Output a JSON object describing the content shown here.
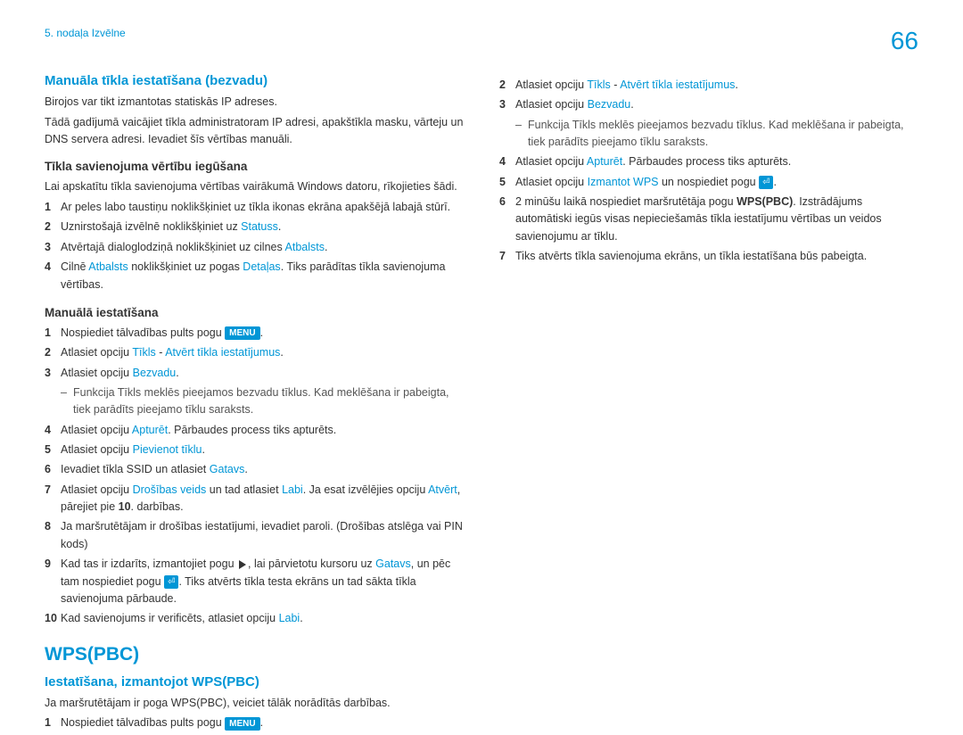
{
  "header": {
    "chapter": "5. nodaļa Izvēlne",
    "page": "66"
  },
  "left": {
    "h2a": "Manuāla tīkla iestatīšana (bezvadu)",
    "p1": "Birojos var tikt izmantotas statiskās IP adreses.",
    "p2": "Tādā gadījumā vaicājiet tīkla administratoram IP adresi, apakštīkla masku, vārteju un DNS servera adresi. Ievadiet šīs vērtības manuāli.",
    "h3a": "Tīkla savienojuma vērtību iegūšana",
    "p3": "Lai apskatītu tīkla savienojuma vērtības vairākumā Windows datoru, rīkojieties šādi.",
    "s1": {
      "1": "Ar peles labo taustiņu noklikšķiniet uz tīkla ikonas ekrāna apakšējā labajā stūrī.",
      "2a": "Uznirstošajā izvēlnē noklikšķiniet uz ",
      "2b": "Statuss",
      "2c": ".",
      "3a": "Atvērtajā dialoglodziņā noklikšķiniet uz cilnes ",
      "3b": "Atbalsts",
      "3c": ".",
      "4a": "Cilnē ",
      "4b": "Atbalsts",
      "4c": " noklikšķiniet uz pogas ",
      "4d": "Detaļas",
      "4e": ". Tiks parādītas tīkla savienojuma vērtības."
    },
    "h3b": "Manuālā iestatīšana",
    "s2": {
      "1a": "Nospiediet tālvadības pults pogu ",
      "1b": "MENU",
      "1c": ".",
      "2a": "Atlasiet opciju ",
      "2b": "Tīkls",
      "2c": " - ",
      "2d": "Atvērt tīkla iestatījumus",
      "2e": ".",
      "3a": "Atlasiet opciju ",
      "3b": "Bezvadu",
      "3c": ".",
      "sub1": "Funkcija Tīkls meklēs pieejamos bezvadu tīklus. Kad meklēšana ir pabeigta, tiek parādīts pieejamo tīklu saraksts.",
      "4a": "Atlasiet opciju ",
      "4b": "Apturēt",
      "4c": ". Pārbaudes process tiks apturēts.",
      "5a": "Atlasiet opciju ",
      "5b": "Pievienot tīklu",
      "5c": ".",
      "6a": "Ievadiet tīkla SSID un atlasiet ",
      "6b": "Gatavs",
      "6c": ".",
      "7a": "Atlasiet opciju ",
      "7b": "Drošības veids",
      "7c": " un tad atlasiet ",
      "7d": "Labi",
      "7e": ". Ja esat izvēlējies opciju ",
      "7f": "Atvērt",
      "7g": ", pārejiet pie ",
      "7h": "10",
      "7i": ". darbības.",
      "8": "Ja maršrutētājam ir drošības iestatījumi, ievadiet paroli. (Drošības atslēga vai PIN kods)",
      "9a": "Kad tas ir izdarīts, izmantojiet pogu ",
      "9b": ", lai pārvietotu kursoru uz ",
      "9c": "Gatavs",
      "9d": ", un pēc tam nospiediet pogu ",
      "9e": ". Tiks atvērts tīkla testa ekrāns un tad sākta tīkla savienojuma pārbaude.",
      "10a": "Kad savienojums ir verificēts, atlasiet opciju ",
      "10b": "Labi",
      "10c": "."
    },
    "h1": "WPS(PBC)",
    "h2b": "Iestatīšana, izmantojot WPS(PBC)",
    "p4": "Ja maršrutētājam ir poga WPS(PBC), veiciet tālāk norādītās darbības.",
    "s3": {
      "1a": "Nospiediet tālvadības pults pogu ",
      "1b": "MENU",
      "1c": "."
    }
  },
  "right": {
    "s": {
      "2a": "Atlasiet opciju ",
      "2b": "Tīkls",
      "2c": " - ",
      "2d": "Atvērt tīkla iestatījumus",
      "2e": ".",
      "3a": "Atlasiet opciju ",
      "3b": "Bezvadu",
      "3c": ".",
      "sub1": "Funkcija Tīkls meklēs pieejamos bezvadu tīklus. Kad meklēšana ir pabeigta, tiek parādīts pieejamo tīklu saraksts.",
      "4a": "Atlasiet opciju ",
      "4b": "Apturēt",
      "4c": ". Pārbaudes process tiks apturēts.",
      "5a": "Atlasiet opciju ",
      "5b": "Izmantot WPS",
      "5c": " un nospiediet pogu ",
      "5d": ".",
      "6a": "2 minūšu laikā nospiediet maršrutētāja pogu ",
      "6b": "WPS(PBC)",
      "6c": ". Izstrādājums automātiski iegūs visas nepieciešamās tīkla iestatījumu vērtības un veidos savienojumu ar tīklu.",
      "7": "Tiks atvērts tīkla savienojuma ekrāns, un tīkla iestatīšana būs pabeigta."
    }
  },
  "icons": {
    "enter": "⏎"
  }
}
